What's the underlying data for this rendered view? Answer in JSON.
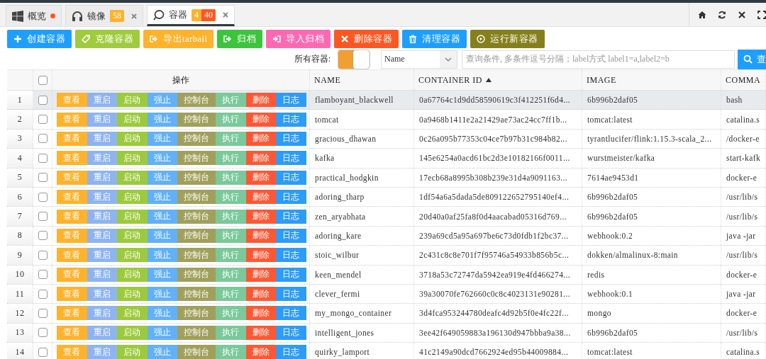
{
  "tabs": [
    {
      "label": "概览",
      "kind": "windows",
      "selected": false,
      "dot": true,
      "closable": false
    },
    {
      "label": "镜像",
      "kind": "headphones",
      "selected": false,
      "dot": false,
      "closable": true,
      "badges": [
        {
          "text": "58",
          "color": "#ffb22b"
        }
      ]
    },
    {
      "label": "容器",
      "kind": "ring",
      "selected": true,
      "dot": false,
      "closable": true,
      "badges": [
        {
          "text": "4",
          "color": "#ffb22b"
        },
        {
          "text": "40",
          "color": "#ff5722"
        }
      ]
    }
  ],
  "toolbar": [
    {
      "label": "创建容器",
      "kind": "plus",
      "color": "#1e9fff"
    },
    {
      "label": "克隆容器",
      "kind": "tag",
      "color": "#9fcb3c"
    },
    {
      "label": "导出tarball",
      "kind": "export",
      "color": "#ffb22b"
    },
    {
      "label": "归档",
      "kind": "export",
      "color": "#3cc43c"
    },
    {
      "label": "导入归档",
      "kind": "import",
      "color": "#ff69b4"
    },
    {
      "label": "删除容器",
      "kind": "cross",
      "color": "#ff5722"
    },
    {
      "label": "清理容器",
      "kind": "trash",
      "color": "#1e9fff"
    },
    {
      "label": "运行新容器",
      "kind": "play",
      "color": "#85801b"
    }
  ],
  "filter": {
    "label": "所有容器:",
    "toggle_on": true,
    "field": "Name",
    "placeholder": "查询条件, 多条件逗号分隔；label方式 label1=a,label2=b",
    "search_button": "查"
  },
  "table": {
    "select_all": false,
    "columns": [
      {
        "label": "操作",
        "sorted": false
      },
      {
        "label": "NAME",
        "sorted": false
      },
      {
        "label": "CONTAINER ID",
        "sorted": true
      },
      {
        "label": "IMAGE",
        "sorted": false
      },
      {
        "label": "COMMA",
        "sorted": false
      }
    ],
    "rows": [
      {
        "no": "1",
        "checked": false,
        "selected": true,
        "actions": [
          "查看",
          "重启",
          "启动",
          "强止",
          "控制台",
          "执行",
          "删除",
          "日志"
        ],
        "name": "flamboyant_blackwell",
        "id": "0a67764c1d9dd58590619c3f412251f6d4...",
        "image": "6b996b2daf05",
        "command": "bash"
      },
      {
        "no": "2",
        "checked": false,
        "selected": false,
        "actions": [
          "查看",
          "重启",
          "启动",
          "强止",
          "控制台",
          "执行",
          "删除",
          "日志"
        ],
        "name": "tomcat",
        "id": "0a9468b1411e2a21429ae73ac24cc7ff1b...",
        "image": "tomcat:latest",
        "command": "catalina.s"
      },
      {
        "no": "3",
        "checked": false,
        "selected": false,
        "actions": [
          "查看",
          "重启",
          "启动",
          "强止",
          "控制台",
          "执行",
          "删除",
          "日志"
        ],
        "name": "gracious_dhawan",
        "id": "0c26a095b77353c04ce7b97b31c984b82...",
        "image": "tyrantlucifer/flink:1.15.3-scala_2...",
        "command": "/docker-e"
      },
      {
        "no": "4",
        "checked": false,
        "selected": false,
        "actions": [
          "查看",
          "重启",
          "启动",
          "强止",
          "控制台",
          "执行",
          "删除",
          "日志"
        ],
        "name": "kafka",
        "id": "145e6254a0acd61bc2d3e10182166f0011...",
        "image": "wurstmeister/kafka",
        "command": "start-kafk"
      },
      {
        "no": "5",
        "checked": false,
        "selected": false,
        "actions": [
          "查看",
          "重启",
          "启动",
          "强止",
          "控制台",
          "执行",
          "删除",
          "日志"
        ],
        "name": "practical_hodgkin",
        "id": "17ecb68a8995b308b239e31d4a9091163...",
        "image": "7614ae9453d1",
        "command": "docker-e"
      },
      {
        "no": "6",
        "checked": false,
        "selected": false,
        "actions": [
          "查看",
          "重启",
          "启动",
          "强止",
          "控制台",
          "执行",
          "删除",
          "日志"
        ],
        "name": "adoring_tharp",
        "id": "1df54a6a5dada5de809122652795140ef4...",
        "image": "6b996b2daf05",
        "command": "/usr/lib/s"
      },
      {
        "no": "7",
        "checked": false,
        "selected": false,
        "actions": [
          "查看",
          "重启",
          "启动",
          "强止",
          "控制台",
          "执行",
          "删除",
          "日志"
        ],
        "name": "zen_aryabhata",
        "id": "20d40a0af25fa8f0d4aacabad05316d769...",
        "image": "6b996b2daf05",
        "command": "/usr/lib/s"
      },
      {
        "no": "8",
        "checked": false,
        "selected": false,
        "actions": [
          "查看",
          "重启",
          "启动",
          "强止",
          "控制台",
          "执行",
          "删除",
          "日志"
        ],
        "name": "adoring_kare",
        "id": "239a69cd5a95a697be6c73d0fdb1f2bc37...",
        "image": "webhook:0.2",
        "command": "java -jar"
      },
      {
        "no": "9",
        "checked": false,
        "selected": false,
        "actions": [
          "查看",
          "重启",
          "启动",
          "强止",
          "控制台",
          "执行",
          "删除",
          "日志"
        ],
        "name": "stoic_wilbur",
        "id": "2c431c8c8e701f7f95746a54933b856b5c...",
        "image": "dokken/almalinux-8:main",
        "command": "/usr/lib/s"
      },
      {
        "no": "10",
        "checked": false,
        "selected": false,
        "actions": [
          "查看",
          "重启",
          "启动",
          "强止",
          "控制台",
          "执行",
          "删除",
          "日志"
        ],
        "name": "keen_mendel",
        "id": "3718a53c72747da5942ea919e4fd466274...",
        "image": "redis",
        "command": "docker-e"
      },
      {
        "no": "11",
        "checked": false,
        "selected": false,
        "actions": [
          "查看",
          "重启",
          "启动",
          "强止",
          "控制台",
          "执行",
          "删除",
          "日志"
        ],
        "name": "clever_fermi",
        "id": "39a30070fe762660c0c8c4023131e90281...",
        "image": "webhook:0.1",
        "command": "java -jar"
      },
      {
        "no": "12",
        "checked": false,
        "selected": false,
        "actions": [
          "查看",
          "重启",
          "启动",
          "强止",
          "控制台",
          "执行",
          "删除",
          "日志"
        ],
        "name": "my_mongo_container",
        "id": "3d4fca953244780deafc4d92b5f0e4fc22f...",
        "image": "mongo",
        "command": "docker-e"
      },
      {
        "no": "13",
        "checked": false,
        "selected": false,
        "actions": [
          "查看",
          "重启",
          "启动",
          "强止",
          "控制台",
          "执行",
          "删除",
          "日志"
        ],
        "name": "intelligent_jones",
        "id": "3ee42f649059883a196130d947bbba9a38...",
        "image": "6b996b2daf05",
        "command": "/usr/lib/s"
      },
      {
        "no": "14",
        "checked": false,
        "selected": false,
        "actions": [
          "查看",
          "重启",
          "启动",
          "强止",
          "控制台",
          "执行",
          "删除",
          "日志"
        ],
        "name": "quirky_lamport",
        "id": "41c2149a90dcd7662924ed95b44009884...",
        "image": "tomcat:latest",
        "command": "catalina.s"
      }
    ]
  }
}
